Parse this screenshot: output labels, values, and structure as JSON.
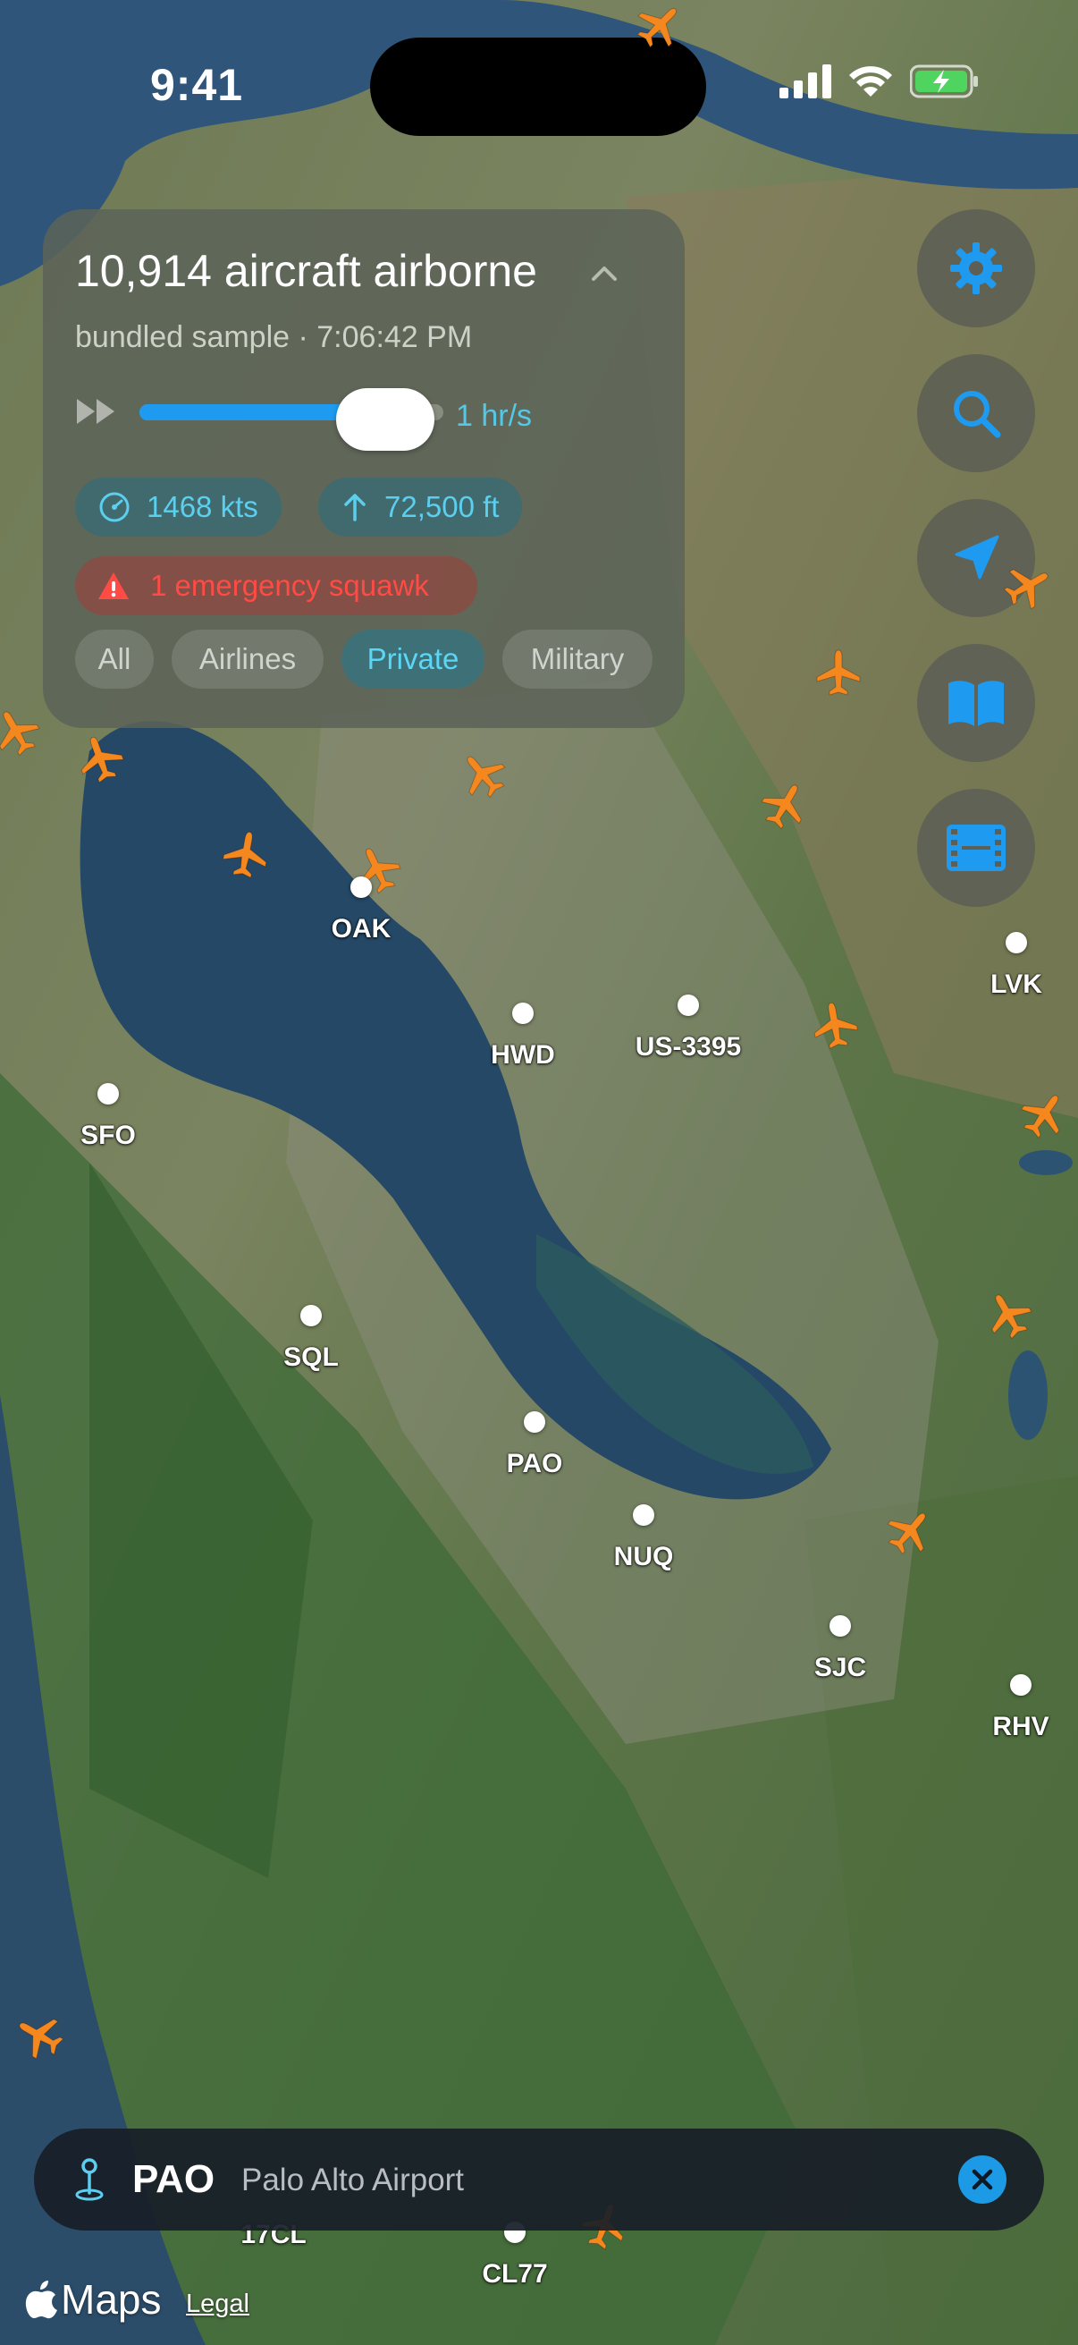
{
  "status_bar": {
    "time": "9:41"
  },
  "panel": {
    "title": "10,914 aircraft airborne",
    "subtitle": "bundled sample · 7:06:42 PM",
    "playback": {
      "speed_label": "1 hr/s",
      "slider_fraction": 0.72
    },
    "stats": {
      "speed": "1468 kts",
      "altitude": "72,500 ft"
    },
    "emergency": "1 emergency squawk",
    "filters": [
      {
        "label": "All",
        "active": false
      },
      {
        "label": "Airlines",
        "active": false
      },
      {
        "label": "Private",
        "active": true
      },
      {
        "label": "Military",
        "active": false
      }
    ]
  },
  "side_buttons": [
    "gear-icon",
    "search-icon",
    "location-arrow-icon",
    "book-icon",
    "film-icon"
  ],
  "airports": [
    "OAK",
    "HWD",
    "US-3395",
    "LVK",
    "SFO",
    "SQL",
    "PAO",
    "NUQ",
    "SJC",
    "RHV",
    "CL77",
    "17CL"
  ],
  "selected_airport": {
    "code": "PAO",
    "name": "Palo Alto Airport"
  },
  "footer": {
    "maps_label": "Maps",
    "legal": "Legal"
  },
  "colors": {
    "accent": "#1e9bf0",
    "cyan": "#5ccfee",
    "plane": "#f5871f",
    "emergency": "#ff4b45"
  }
}
